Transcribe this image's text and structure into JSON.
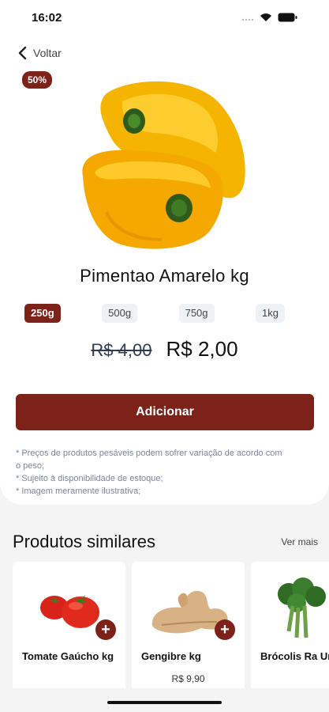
{
  "status_bar": {
    "time": "16:02"
  },
  "nav": {
    "back_label": "Voltar"
  },
  "product": {
    "discount_badge": "50%",
    "title": "Pimentao Amarelo  kg",
    "weights": [
      "250g",
      "500g",
      "750g",
      "1kg"
    ],
    "selected_weight": "250g",
    "old_price": "R$ 4,00",
    "new_price": "R$ 2,00",
    "add_label": "Adicionar",
    "disclaimer": [
      "* Preços de produtos pesáveis podem sofrer variação de acordo com o peso;",
      "* Sujeito à disponibilidade de estoque;",
      "* Imagem meramente ilustrativa;"
    ]
  },
  "similar": {
    "title": "Produtos similares",
    "see_more": "Ver mais",
    "items": [
      {
        "name": "Tomate Gaúcho kg",
        "price": ""
      },
      {
        "name": "Gengibre kg",
        "price": "R$ 9,90"
      },
      {
        "name": "Brócolis Ra Unidade",
        "price": ""
      }
    ]
  },
  "colors": {
    "accent": "#7d2219",
    "chip_bg": "#eef1f6"
  }
}
